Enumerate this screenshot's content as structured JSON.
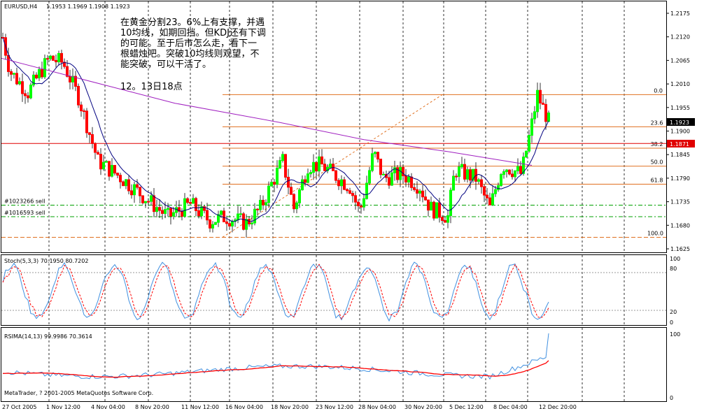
{
  "header": {
    "symbol": "EURUSD,H4",
    "ohlc": "1.1953 1.1969 1.1908 1.1923"
  },
  "annotation": {
    "lines": [
      "在黄金分割23。6%上有支撑，并遇",
      "10均线，如期回挡。但KDJ还有下调",
      "的可能。至于后市怎么走，看下一",
      "根蜡烛吧。突破10均线则观望，不",
      "能突破，可以干活了。"
    ],
    "timestamp": "12。13日18点"
  },
  "price_axis": {
    "labels": [
      "1.2175",
      "1.2120",
      "1.2065",
      "1.2010",
      "1.1955",
      "1.1900",
      "1.1845",
      "1.1790",
      "1.1735",
      "1.1680",
      "1.1625"
    ],
    "current_price": "1.1923",
    "ref_line_price": "1.1871"
  },
  "fibonacci": {
    "levels": [
      {
        "label": "0.0",
        "price": 1.1985
      },
      {
        "label": "23.6",
        "price": 1.191
      },
      {
        "label": "38.2",
        "price": 1.186
      },
      {
        "label": "50.0",
        "price": 1.1818
      },
      {
        "label": "61.8",
        "price": 1.1776
      },
      {
        "label": "100.0",
        "price": 1.1652
      }
    ]
  },
  "orders": [
    {
      "label": "#1023266 sell",
      "price": 1.1727
    },
    {
      "label": "#1016593 sell",
      "price": 1.17
    }
  ],
  "stoch": {
    "title": "Stoch(5,3,3) 70.1950 80.7202",
    "levels": [
      "100",
      "80",
      "20",
      "0"
    ]
  },
  "rsima": {
    "title": "RSIMA(14,13) 99.9986 70.3614",
    "levels": [
      "100",
      "0"
    ],
    "copyright": "MetaTrader, ? 2001-2005 MetaQuotes Software Corp."
  },
  "time_axis": {
    "labels": [
      "27 Oct 2005",
      "1 Nov 12:00",
      "4 Nov 04:00",
      "8 Nov 20:00",
      "11 Nov 12:00",
      "16 Nov 04:00",
      "18 Nov 20:00",
      "23 Nov 12:00",
      "28 Nov 04:00",
      "30 Nov 20:00",
      "5 Dec 12:00",
      "8 Dec 04:00",
      "12 Dec 20:00"
    ]
  },
  "colors": {
    "bull": "#00ff00",
    "bear": "#ff0000",
    "fib": "#e07020",
    "ma10": "#000080",
    "ma_long": "#a020c0",
    "stoch_main": "#4090e0",
    "stoch_signal": "#ff0000",
    "rsi": "#4090e0",
    "rsi_ma": "#ff0000"
  }
}
